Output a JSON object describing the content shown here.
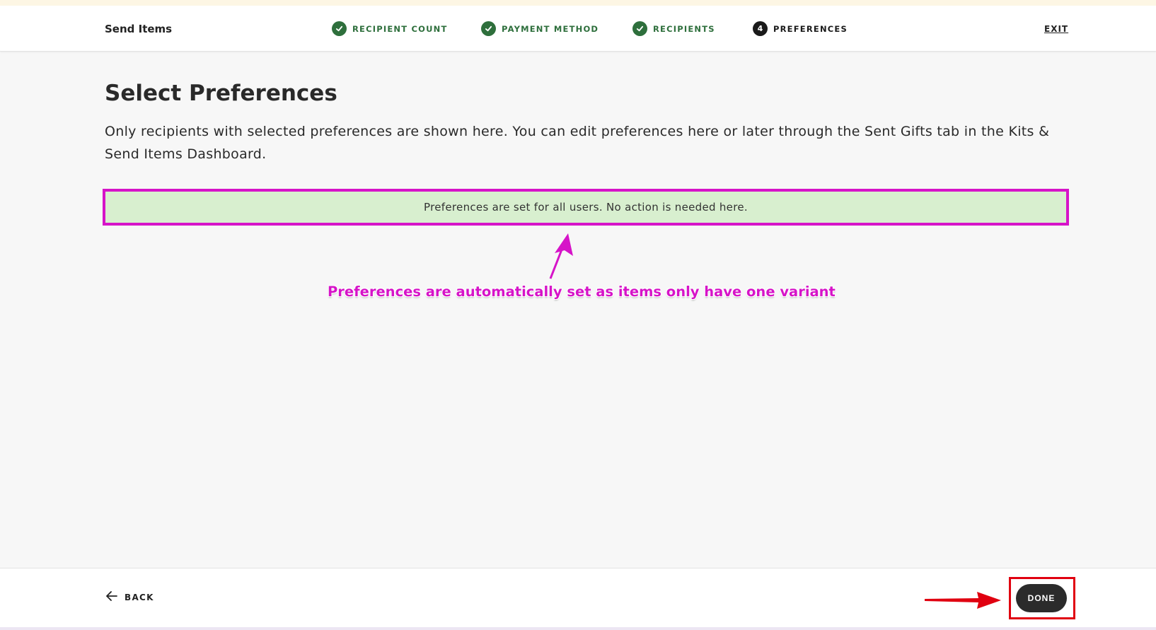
{
  "header": {
    "title": "Send Items",
    "steps": [
      {
        "label": "RECIPIENT COUNT",
        "status": "done"
      },
      {
        "label": "PAYMENT METHOD",
        "status": "done"
      },
      {
        "label": "RECIPIENTS",
        "status": "done"
      },
      {
        "label": "PREFERENCES",
        "status": "active",
        "number": "4"
      }
    ],
    "exit_label": "EXIT"
  },
  "main": {
    "title": "Select Preferences",
    "description": "Only recipients with selected preferences are shown here. You can edit preferences here or later through the Sent Gifts tab in the Kits & Send Items Dashboard.",
    "notice": "Preferences are set for all users. No action is needed here."
  },
  "annotation": {
    "text": "Preferences are automatically set as items only have one variant"
  },
  "footer": {
    "back_label": "BACK",
    "done_label": "DONE"
  },
  "colors": {
    "success_green": "#2e6f3c",
    "notice_bg": "#d8efcf",
    "annotation_magenta": "#d614c8",
    "highlight_red": "#e00010",
    "primary_button": "#2b2b2b"
  }
}
